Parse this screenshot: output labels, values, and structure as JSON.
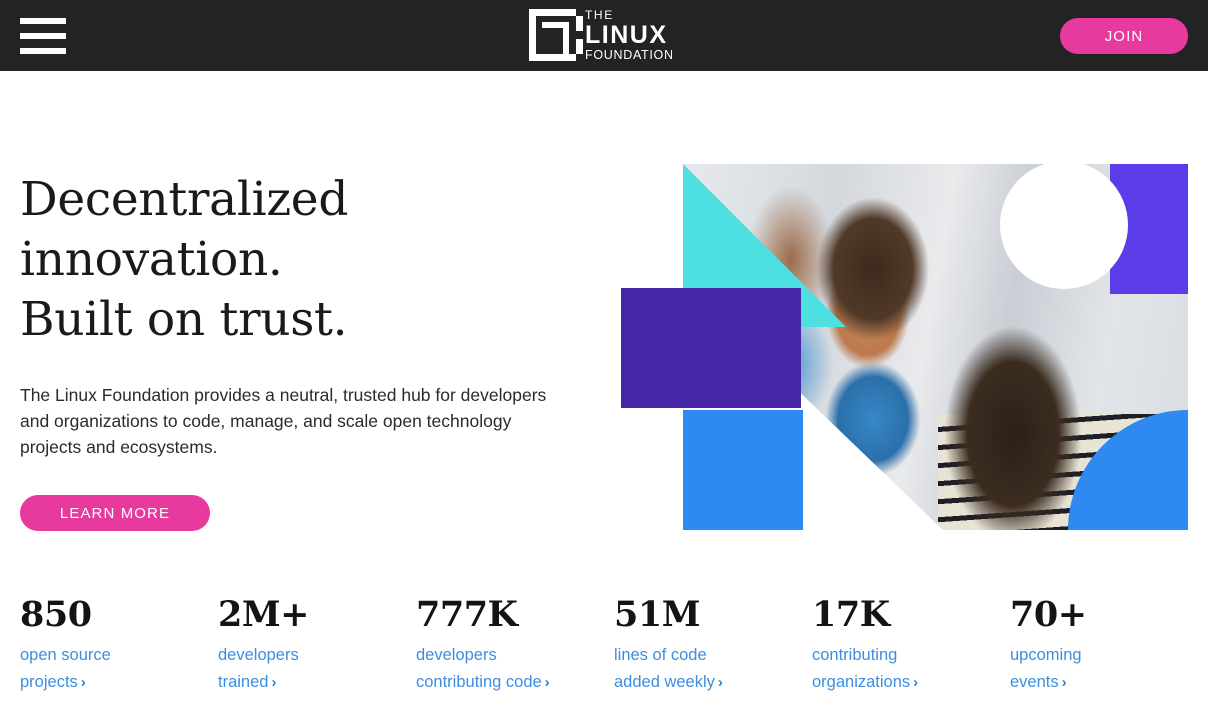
{
  "header": {
    "menu_icon": "hamburger-menu-icon",
    "logo": {
      "line1": "THE",
      "line2": "LINUX",
      "line3": "FOUNDATION",
      "mark": "linux-foundation-mark-icon"
    },
    "join_label": "JOIN",
    "background_color": "#232323",
    "accent_color": "#e8399f"
  },
  "hero": {
    "headline_line1": "Decentralized",
    "headline_line2": "innovation.",
    "headline_line3": "Built on trust.",
    "subtext": "The Linux Foundation provides a neutral, trusted hub for developers and organizations to code, manage, and scale open technology projects and ecosystems.",
    "cta_label": "LEARN MORE",
    "image_alt": "Two smiling women with glasses talking at a conference",
    "shape_colors": {
      "cyan": "#4ee0e0",
      "purple": "#4527a8",
      "blue": "#2e8af0",
      "violet": "#5b3ce8",
      "white": "#ffffff"
    }
  },
  "stats": [
    {
      "number": "850",
      "label_line1": "open source",
      "label_line2": "projects",
      "chevron": "chevron-right-icon"
    },
    {
      "number": "2M+",
      "label_line1": "developers",
      "label_line2": "trained",
      "chevron": "chevron-right-icon"
    },
    {
      "number": "777K",
      "label_line1": "developers",
      "label_line2": "contributing code",
      "chevron": "chevron-right-icon"
    },
    {
      "number": "51M",
      "label_line1": "lines of code",
      "label_line2": "added weekly",
      "chevron": "chevron-right-icon"
    },
    {
      "number": "17K",
      "label_line1": "contributing",
      "label_line2": "organizations",
      "chevron": "chevron-right-icon"
    },
    {
      "number": "70+",
      "label_line1": "upcoming",
      "label_line2": "events",
      "chevron": "chevron-right-icon"
    }
  ],
  "stats_link_color": "#3d8ee0"
}
